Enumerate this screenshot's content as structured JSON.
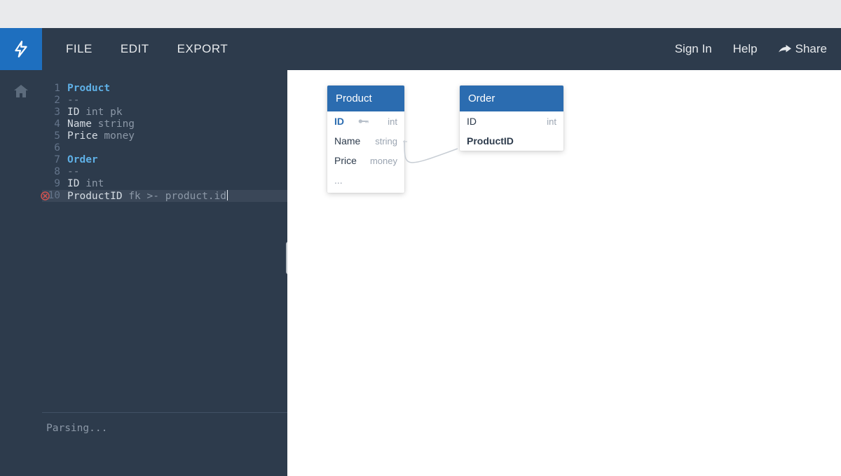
{
  "toolbar": {
    "menu": {
      "file": "FILE",
      "edit": "EDIT",
      "export": "EXPORT"
    },
    "signin": "Sign In",
    "help": "Help",
    "share": "Share"
  },
  "editor": {
    "lines": [
      {
        "n": "1",
        "cls": "tok-entity",
        "text": "Product"
      },
      {
        "n": "2",
        "cls": "tok-dim",
        "text": "--"
      },
      {
        "n": "3",
        "segments": [
          {
            "cls": "tok-field",
            "text": "ID "
          },
          {
            "cls": "tok-type",
            "text": "int pk"
          }
        ]
      },
      {
        "n": "4",
        "segments": [
          {
            "cls": "tok-field",
            "text": "Name "
          },
          {
            "cls": "tok-type",
            "text": "string"
          }
        ]
      },
      {
        "n": "5",
        "segments": [
          {
            "cls": "tok-field",
            "text": "Price "
          },
          {
            "cls": "tok-type",
            "text": "money"
          }
        ]
      },
      {
        "n": "6",
        "text": ""
      },
      {
        "n": "7",
        "cls": "tok-entity",
        "text": "Order"
      },
      {
        "n": "8",
        "cls": "tok-dim",
        "text": "--"
      },
      {
        "n": "9",
        "segments": [
          {
            "cls": "tok-field",
            "text": "ID "
          },
          {
            "cls": "tok-type",
            "text": "int"
          }
        ]
      },
      {
        "n": "10",
        "error": true,
        "active": true,
        "cursor": true,
        "segments": [
          {
            "cls": "tok-field",
            "text": "ProductID "
          },
          {
            "cls": "tok-type",
            "text": "fk >- product.id"
          }
        ]
      }
    ],
    "status": "Parsing..."
  },
  "diagram": {
    "tables": [
      {
        "id": "product",
        "title": "Product",
        "rows": [
          {
            "name": "ID",
            "type": "int",
            "pk": true
          },
          {
            "name": "Name",
            "type": "string"
          },
          {
            "name": "Price",
            "type": "money"
          },
          {
            "ellipsis": "..."
          }
        ]
      },
      {
        "id": "order",
        "title": "Order",
        "rows": [
          {
            "name": "ID",
            "type": "int"
          },
          {
            "name": "ProductID",
            "bold": true
          }
        ]
      }
    ]
  }
}
